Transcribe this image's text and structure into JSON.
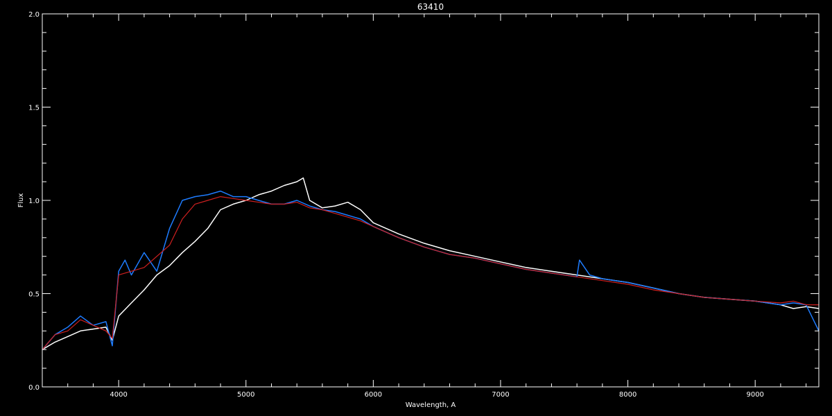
{
  "chart_data": {
    "type": "line",
    "title": "63410",
    "xlabel": "Wavelength, A",
    "ylabel": "Flux",
    "xlim": [
      3400,
      9500
    ],
    "ylim": [
      0.0,
      2.0
    ],
    "x_ticks": [
      4000,
      5000,
      6000,
      7000,
      8000,
      9000
    ],
    "x_tick_labels": [
      "4000",
      "5000",
      "6000",
      "7000",
      "8000",
      "9000"
    ],
    "y_ticks": [
      0.0,
      0.5,
      1.0,
      1.5,
      2.0
    ],
    "y_tick_labels": [
      "0.0",
      "0.5",
      "1.0",
      "1.5",
      "2.0"
    ],
    "grid": false,
    "background": "#000000",
    "axis_color": "#ffffff",
    "series": [
      {
        "color": "#ffffff",
        "x": [
          3400,
          3500,
          3600,
          3700,
          3800,
          3900,
          3950,
          4000,
          4100,
          4200,
          4300,
          4400,
          4500,
          4600,
          4700,
          4800,
          4900,
          5000,
          5100,
          5200,
          5300,
          5400,
          5450,
          5500,
          5600,
          5700,
          5800,
          5900,
          6000,
          6200,
          6400,
          6600,
          6800,
          7000,
          7200,
          7400,
          7600,
          7800,
          8000,
          8200,
          8400,
          8600,
          8800,
          9000,
          9200,
          9300,
          9400,
          9500
        ],
        "y": [
          0.2,
          0.24,
          0.27,
          0.3,
          0.31,
          0.32,
          0.25,
          0.38,
          0.45,
          0.52,
          0.6,
          0.65,
          0.72,
          0.78,
          0.85,
          0.95,
          0.98,
          1.0,
          1.03,
          1.05,
          1.08,
          1.1,
          1.12,
          1.0,
          0.96,
          0.97,
          0.99,
          0.95,
          0.88,
          0.82,
          0.77,
          0.73,
          0.7,
          0.67,
          0.64,
          0.62,
          0.6,
          0.58,
          0.56,
          0.53,
          0.5,
          0.48,
          0.47,
          0.46,
          0.44,
          0.42,
          0.43,
          0.42
        ]
      },
      {
        "color": "#1e7cff",
        "x": [
          3400,
          3500,
          3600,
          3700,
          3800,
          3900,
          3950,
          4000,
          4050,
          4100,
          4200,
          4300,
          4400,
          4500,
          4600,
          4700,
          4800,
          4900,
          5000,
          5100,
          5200,
          5300,
          5400,
          5500,
          5600,
          5700,
          5800,
          5900,
          6000,
          6200,
          6400,
          6600,
          6800,
          7000,
          7200,
          7400,
          7600,
          7620,
          7700,
          7800,
          8000,
          8200,
          8400,
          8600,
          8800,
          9000,
          9200,
          9300,
          9400,
          9500
        ],
        "y": [
          0.2,
          0.28,
          0.32,
          0.38,
          0.33,
          0.35,
          0.22,
          0.62,
          0.68,
          0.6,
          0.72,
          0.62,
          0.85,
          1.0,
          1.02,
          1.03,
          1.05,
          1.02,
          1.02,
          1.0,
          0.98,
          0.98,
          1.0,
          0.97,
          0.95,
          0.94,
          0.92,
          0.9,
          0.86,
          0.8,
          0.75,
          0.71,
          0.69,
          0.66,
          0.63,
          0.61,
          0.59,
          0.68,
          0.6,
          0.58,
          0.56,
          0.53,
          0.5,
          0.48,
          0.47,
          0.46,
          0.44,
          0.45,
          0.44,
          0.3
        ]
      },
      {
        "color": "#d02020",
        "x": [
          3400,
          3500,
          3600,
          3700,
          3800,
          3900,
          3950,
          4000,
          4100,
          4200,
          4300,
          4400,
          4500,
          4600,
          4700,
          4800,
          4900,
          5000,
          5100,
          5200,
          5300,
          5400,
          5500,
          5600,
          5700,
          5800,
          5900,
          6000,
          6200,
          6400,
          6600,
          6800,
          7000,
          7200,
          7400,
          7600,
          7800,
          8000,
          8200,
          8400,
          8600,
          8800,
          9000,
          9200,
          9300,
          9400,
          9500
        ],
        "y": [
          0.2,
          0.28,
          0.3,
          0.36,
          0.33,
          0.3,
          0.26,
          0.6,
          0.62,
          0.64,
          0.7,
          0.76,
          0.9,
          0.98,
          1.0,
          1.02,
          1.01,
          1.0,
          0.99,
          0.98,
          0.98,
          0.99,
          0.96,
          0.95,
          0.93,
          0.91,
          0.89,
          0.86,
          0.8,
          0.75,
          0.71,
          0.69,
          0.66,
          0.63,
          0.61,
          0.59,
          0.57,
          0.55,
          0.52,
          0.5,
          0.48,
          0.47,
          0.46,
          0.45,
          0.46,
          0.44,
          0.44
        ]
      }
    ]
  }
}
